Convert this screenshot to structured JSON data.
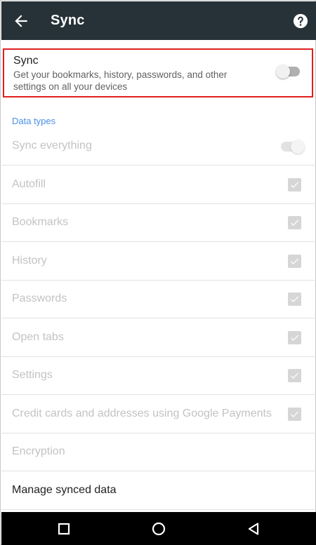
{
  "appbar": {
    "title": "Sync",
    "back_icon": "arrow-left-icon",
    "help_icon": "help-circle-icon"
  },
  "sync": {
    "title": "Sync",
    "description": "Get your bookmarks, history, passwords, and other settings on all your devices",
    "enabled": false
  },
  "data_types": {
    "header": "Data types",
    "sync_everything_label": "Sync everything",
    "sync_everything_enabled": true,
    "items": [
      {
        "label": "Autofill",
        "checked": true
      },
      {
        "label": "Bookmarks",
        "checked": true
      },
      {
        "label": "History",
        "checked": true
      },
      {
        "label": "Passwords",
        "checked": true
      },
      {
        "label": "Open tabs",
        "checked": true
      },
      {
        "label": "Settings",
        "checked": true
      },
      {
        "label": "Credit cards and addresses using Google Payments",
        "checked": true
      }
    ],
    "encryption_label": "Encryption",
    "manage_label": "Manage synced data"
  },
  "navbar": {
    "recents_icon": "square-icon",
    "home_icon": "circle-icon",
    "back_icon": "triangle-back-icon"
  },
  "colors": {
    "appbar": "#263238",
    "accent": "#4a8fe7",
    "highlight_border": "#e02020"
  }
}
